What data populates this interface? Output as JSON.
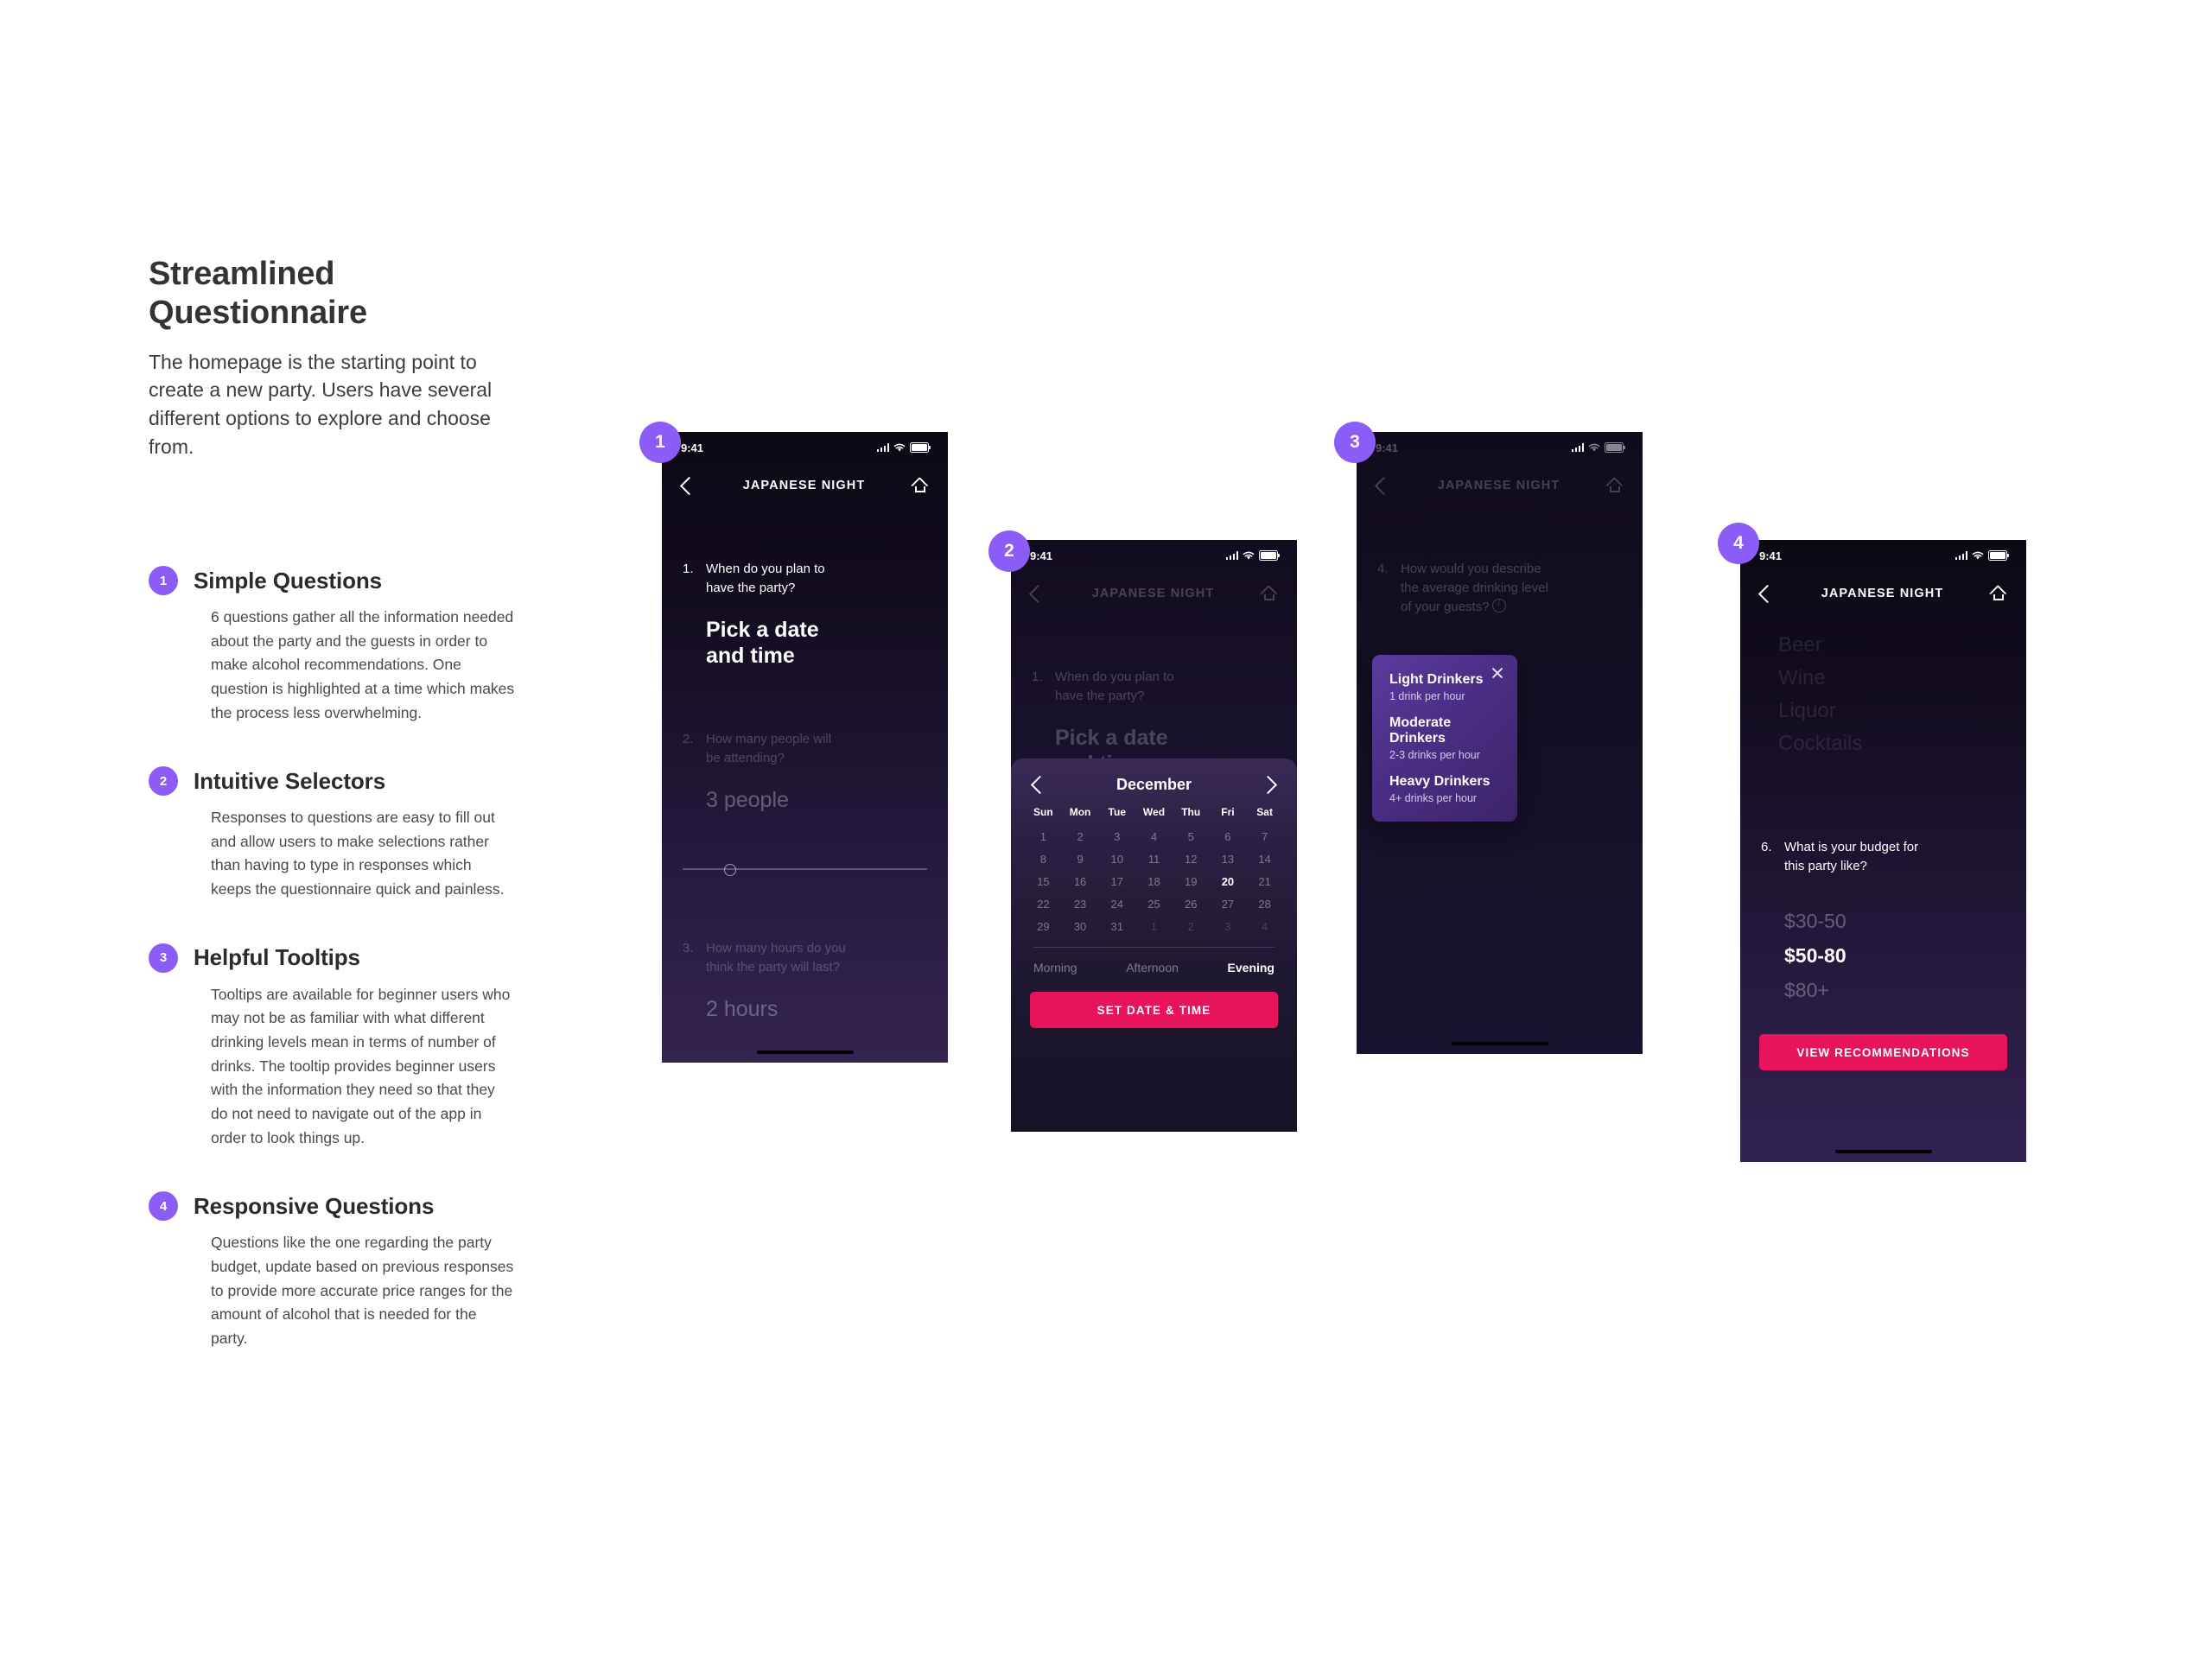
{
  "article": {
    "title": "Streamlined\nQuestionnaire",
    "intro": "The homepage is the starting point to create a new party. Users have several different options to explore and choose from.",
    "features": [
      {
        "number": "1",
        "title": "Simple Questions",
        "body": "6 questions gather all the information needed about the party and the guests in order to make alcohol recommendations. One question is highlighted at a time which makes the process less overwhelming."
      },
      {
        "number": "2",
        "title": "Intuitive Selectors",
        "body": "Responses to questions are easy to fill out and allow users to make selections rather than having to type in responses which keeps the questionnaire quick and painless."
      },
      {
        "number": "3",
        "title": "Helpful Tooltips",
        "body": "Tooltips are available for beginner users who may not be as familiar with what different drinking levels mean in terms of number of drinks. The tooltip provides beginner users with the information they need so that they do not need to navigate out of the app in order to look things up."
      },
      {
        "number": "4",
        "title": "Responsive Questions",
        "body": "Questions like the one regarding the party budget, update based on previous responses to provide more accurate price ranges for the amount of alcohol that is needed for the party."
      }
    ]
  },
  "colors": {
    "badge_purple": "#8b5cf6",
    "cta_pink": "#e8145b",
    "tooltip_purple": "#5b3b9e"
  },
  "status_bar": {
    "time": "9:41",
    "signal_icon": "signal-bars-icon",
    "wifi_icon": "wifi-icon",
    "battery_icon": "battery-icon"
  },
  "nav": {
    "title": "JAPANESE NIGHT",
    "back_icon": "chevron-left-icon",
    "home_icon": "home-icon"
  },
  "phones": [
    {
      "badge": "1",
      "questions": [
        {
          "num": "1.",
          "text": "When do you plan to\nhave the party?",
          "answer": "Pick a date\nand time"
        },
        {
          "num": "2.",
          "text": "How many people will\nbe attending?",
          "answer": "3 people"
        },
        {
          "num": "3.",
          "text": "How many hours do you\nthink the party will last?",
          "answer": "2 hours"
        }
      ]
    },
    {
      "badge": "2",
      "questions": [
        {
          "num": "1.",
          "text": "When do you plan to\nhave the party?",
          "answer": "Pick a date\nand time"
        }
      ],
      "calendar": {
        "month": "December",
        "prev_icon": "chevron-left-icon",
        "next_icon": "chevron-right-icon",
        "dow": [
          "Sun",
          "Mon",
          "Tue",
          "Wed",
          "Thu",
          "Fri",
          "Sat"
        ],
        "selected_day": "20",
        "weeks": [
          [
            {
              "d": "1"
            },
            {
              "d": "2"
            },
            {
              "d": "3"
            },
            {
              "d": "4"
            },
            {
              "d": "5"
            },
            {
              "d": "6"
            },
            {
              "d": "7"
            }
          ],
          [
            {
              "d": "8"
            },
            {
              "d": "9"
            },
            {
              "d": "10"
            },
            {
              "d": "11"
            },
            {
              "d": "12"
            },
            {
              "d": "13"
            },
            {
              "d": "14"
            }
          ],
          [
            {
              "d": "15"
            },
            {
              "d": "16"
            },
            {
              "d": "17"
            },
            {
              "d": "18"
            },
            {
              "d": "19"
            },
            {
              "d": "20",
              "sel": true
            },
            {
              "d": "21"
            }
          ],
          [
            {
              "d": "22"
            },
            {
              "d": "23"
            },
            {
              "d": "24"
            },
            {
              "d": "25"
            },
            {
              "d": "26"
            },
            {
              "d": "27"
            },
            {
              "d": "28"
            }
          ],
          [
            {
              "d": "29"
            },
            {
              "d": "30"
            },
            {
              "d": "31"
            },
            {
              "d": "1",
              "other": true
            },
            {
              "d": "2",
              "other": true
            },
            {
              "d": "3",
              "other": true
            },
            {
              "d": "4",
              "other": true
            }
          ]
        ],
        "times": [
          {
            "label": "Morning",
            "active": false
          },
          {
            "label": "Afternoon",
            "active": false
          },
          {
            "label": "Evening",
            "active": true
          }
        ],
        "cta": "SET DATE & TIME"
      }
    },
    {
      "badge": "3",
      "questions": [
        {
          "num": "4.",
          "text": "How would you describe\nthe average drinking level\nof your guests?",
          "info_icon": "info-circle-icon"
        }
      ],
      "tooltip": {
        "close_icon": "close-icon",
        "items": [
          {
            "title": "Light Drinkers",
            "sub": "1 drink per hour"
          },
          {
            "title": "Moderate Drinkers",
            "sub": "2-3 drinks per hour"
          },
          {
            "title": "Heavy Drinkers",
            "sub": "4+ drinks per hour"
          }
        ]
      }
    },
    {
      "badge": "4",
      "drink_types": [
        "Beer",
        "Wine",
        "Liquor",
        "Cocktails"
      ],
      "questions": [
        {
          "num": "6.",
          "text": "What is your budget for\nthis party like?"
        }
      ],
      "budget_options": [
        {
          "label": "$30-50",
          "selected": false
        },
        {
          "label": "$50-80",
          "selected": true
        },
        {
          "label": "$80+",
          "selected": false
        }
      ],
      "cta": "VIEW RECOMMENDATIONS"
    }
  ]
}
